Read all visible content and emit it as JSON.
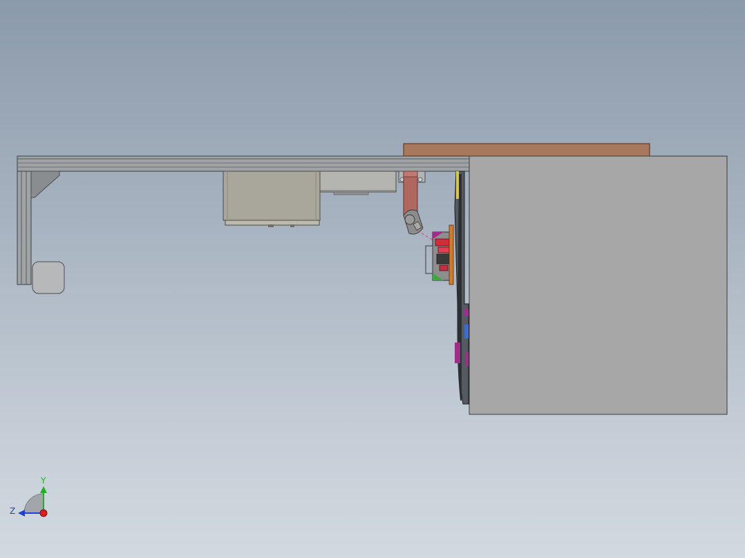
{
  "viewport": {
    "background_top": "#8b9aab",
    "background_bottom": "#d2d9e0"
  },
  "model": {
    "frame_color": "#9ea3a5",
    "frame_edge_color": "#3c3e40",
    "cabinet_color": "#a9a79b",
    "tabletop_color": "#a8785c",
    "enclosure_color": "#a7a7a7",
    "arm_color": "#b0675f",
    "gripper_color": "#d12c3a",
    "accent_magenta": "#a02c8c",
    "accent_green": "#3aa83a",
    "accent_orange": "#d07a2a",
    "accent_blue": "#3a6ed0"
  },
  "triad": {
    "y_label": "Y",
    "z_label": "Z",
    "y_color": "#1fb21f",
    "z_color": "#1f3fd8",
    "x_color": "#d81f1f"
  }
}
